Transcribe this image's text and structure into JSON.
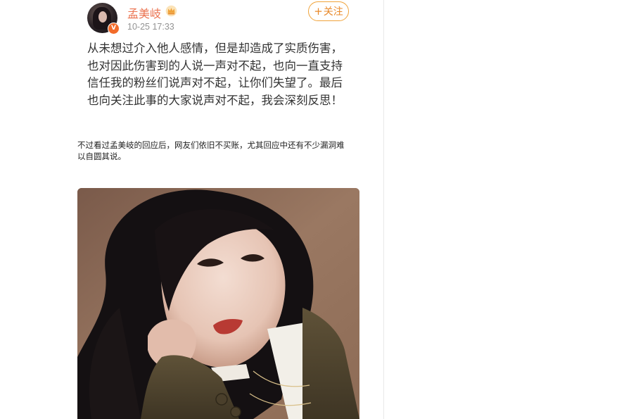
{
  "post": {
    "author": {
      "name": "孟美岐",
      "verified_badge": "V",
      "avatar_icon": "avatar-portrait-icon",
      "member_icon": "crown-icon"
    },
    "timestamp": "10-25 17:33",
    "follow_button": {
      "plus": "+",
      "label": "关注"
    },
    "body_lines": [
      "从未想过介入他人感情，但是却造成了实质伤害，",
      "也对因此伤害到的人说一声对不起，也向一直支持",
      "信任我的粉丝们说声对不起，让你们失望了。最后",
      "也向关注此事的大家说声对不起，我会深刻反思！"
    ]
  },
  "article": {
    "caption_lines": [
      "不过看过孟美岐的回应后，网友们依旧不买账，尤其回应中还有不少漏洞难",
      "以自圆其说。"
    ]
  },
  "colors": {
    "username": "#eb7350",
    "follow_border": "#f0a33a",
    "verified": "#f26b2a",
    "timestamp": "#939393",
    "photo_background": "#8a6a58"
  }
}
